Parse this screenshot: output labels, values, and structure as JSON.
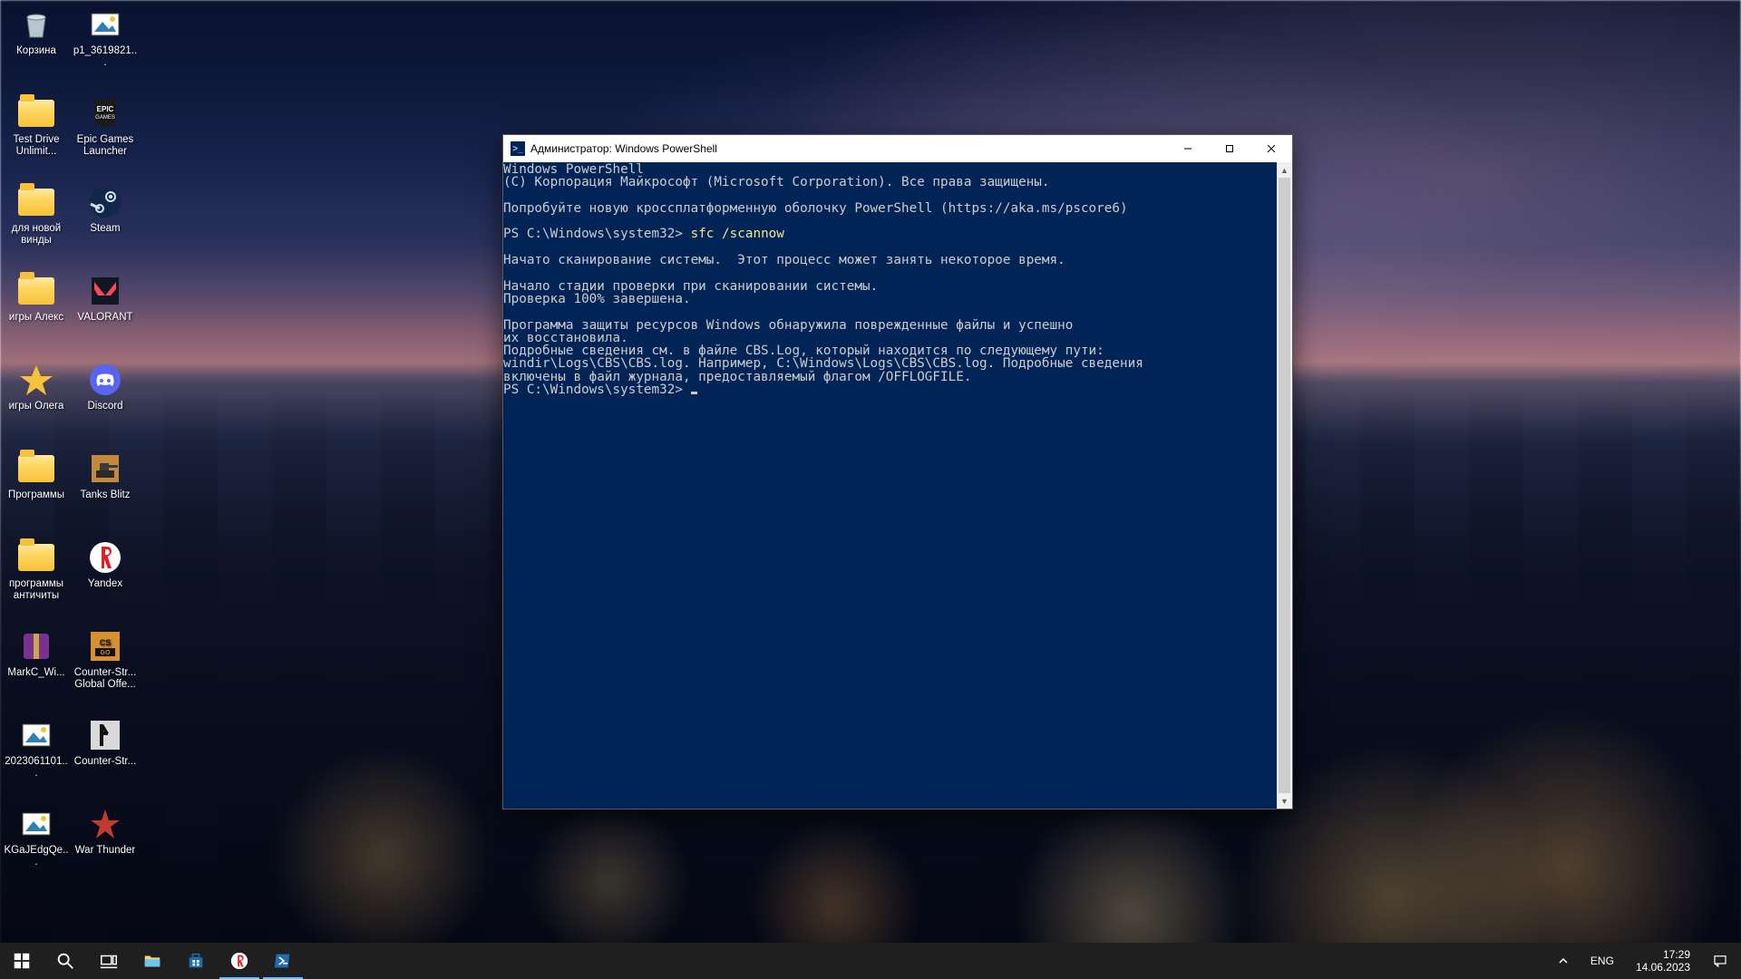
{
  "desktop": {
    "icons_col1": [
      {
        "name": "recycle-bin",
        "label": "Корзина",
        "glyph": "bin"
      },
      {
        "name": "folder-test-drive",
        "label": "Test Drive Unlimit...",
        "glyph": "folder"
      },
      {
        "name": "folder-new-windows",
        "label": "для новой винды",
        "glyph": "folder"
      },
      {
        "name": "folder-games-alex",
        "label": "игры Алекс",
        "glyph": "folder"
      },
      {
        "name": "folder-games-oleg",
        "label": "игры Олега",
        "glyph": "star"
      },
      {
        "name": "folder-programs",
        "label": "Программы",
        "glyph": "folder"
      },
      {
        "name": "folder-anticheat",
        "label": "программы античиты",
        "glyph": "folder"
      },
      {
        "name": "archive-markc",
        "label": "MarkC_Wi...",
        "glyph": "archive"
      },
      {
        "name": "image-20230611",
        "label": "2023061101...",
        "glyph": "image"
      },
      {
        "name": "file-kgajedgqe",
        "label": "KGaJEdgQe...",
        "glyph": "image"
      }
    ],
    "icons_col2": [
      {
        "name": "image-p1",
        "label": "p1_3619821...",
        "glyph": "image"
      },
      {
        "name": "shortcut-epic",
        "label": "Epic Games Launcher",
        "glyph": "epic"
      },
      {
        "name": "shortcut-steam",
        "label": "Steam",
        "glyph": "steam"
      },
      {
        "name": "shortcut-valorant",
        "label": "VALORANT",
        "glyph": "valorant"
      },
      {
        "name": "shortcut-discord",
        "label": "Discord",
        "glyph": "discord"
      },
      {
        "name": "shortcut-tanks-blitz",
        "label": "Tanks Blitz",
        "glyph": "tanks"
      },
      {
        "name": "shortcut-yandex",
        "label": "Yandex",
        "glyph": "yandex"
      },
      {
        "name": "shortcut-csgo",
        "label": "Counter-Str... Global Offe...",
        "glyph": "csgo"
      },
      {
        "name": "shortcut-cs16",
        "label": "Counter-Str...",
        "glyph": "cs16"
      },
      {
        "name": "shortcut-warthunder",
        "label": "War Thunder",
        "glyph": "warthunder"
      }
    ]
  },
  "window": {
    "title": "Администратор: Windows PowerShell",
    "minimize": "—",
    "maximize": "□",
    "close": "✕",
    "prompt1_prefix": "PS C:\\Windows\\system32> ",
    "command1": "sfc",
    "command1_args": " /scannow",
    "prompt2_prefix": "PS C:\\Windows\\system32> ",
    "lines": [
      "Windows PowerShell",
      "(C) Корпорация Майкрософт (Microsoft Corporation). Все права защищены.",
      "",
      "Попробуйте новую кроссплатформенную оболочку PowerShell (https://aka.ms/pscore6)",
      "",
      "__PROMPT1__",
      "",
      "Начато сканирование системы.  Этот процесс может занять некоторое время.",
      "",
      "Начало стадии проверки при сканировании системы.",
      "Проверка 100% завершена.",
      "",
      "Программа защиты ресурсов Windows обнаружила поврежденные файлы и успешно",
      "их восстановила.",
      "Подробные сведения см. в файле CBS.Log, который находится по следующему пути:",
      "windir\\Logs\\CBS\\CBS.log. Например, C:\\Windows\\Logs\\CBS\\CBS.log. Подробные сведения",
      "включены в файл журнала, предоставляемый флагом /OFFLOGFILE.",
      "__PROMPT2__"
    ]
  },
  "taskbar": {
    "lang": "ENG",
    "time": "17:29",
    "date": "14.06.2023"
  },
  "colors": {
    "terminal_bg": "#012456",
    "terminal_fg": "#cccccc",
    "command_fg": "#f0e68c"
  }
}
